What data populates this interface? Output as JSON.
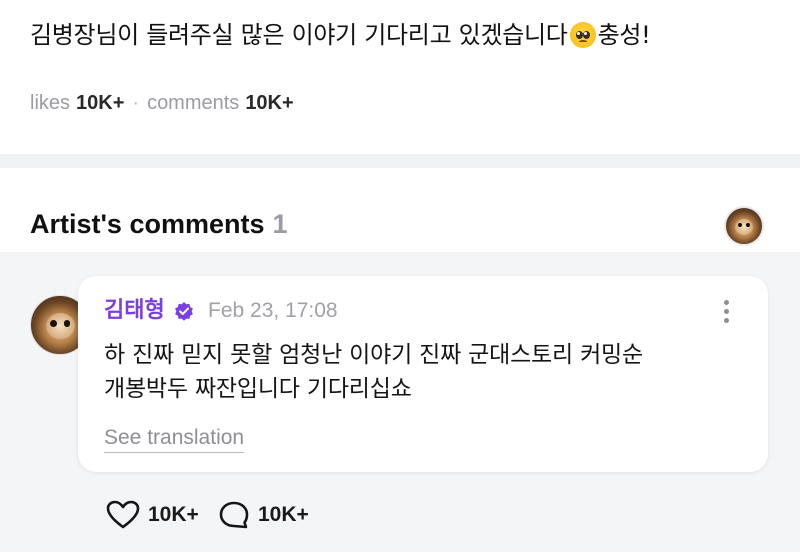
{
  "post": {
    "text": "김병장님이 들려주실 많은 이야기 기다리고 있겠습니다",
    "text_after_emoji": "충성!",
    "emoji": "pleading-face-emoji"
  },
  "stats": {
    "likes_label": "likes",
    "likes_count": "10K+",
    "separator": "·",
    "comments_label": "comments",
    "comments_count": "10K+"
  },
  "artist_comments": {
    "title": "Artist's comments",
    "count": "1"
  },
  "comment": {
    "author": "김태형",
    "verified_icon": "verified-check-icon",
    "timestamp": "Feb 23, 17:08",
    "text_line1": "하 진짜 믿지 못할 엄청난 이야기 진짜 군대스토리 커밍순",
    "text_line2": "개봉박두 짜잔입니다 기다리십쇼",
    "see_translation": "See translation",
    "likes": "10K+",
    "replies": "10K+"
  },
  "colors": {
    "author": "#7a3fe0",
    "verified": "#7a3fe0",
    "muted": "#9a9ca2",
    "band": "#f1f2f4",
    "gray_area": "#f4f5f7"
  }
}
